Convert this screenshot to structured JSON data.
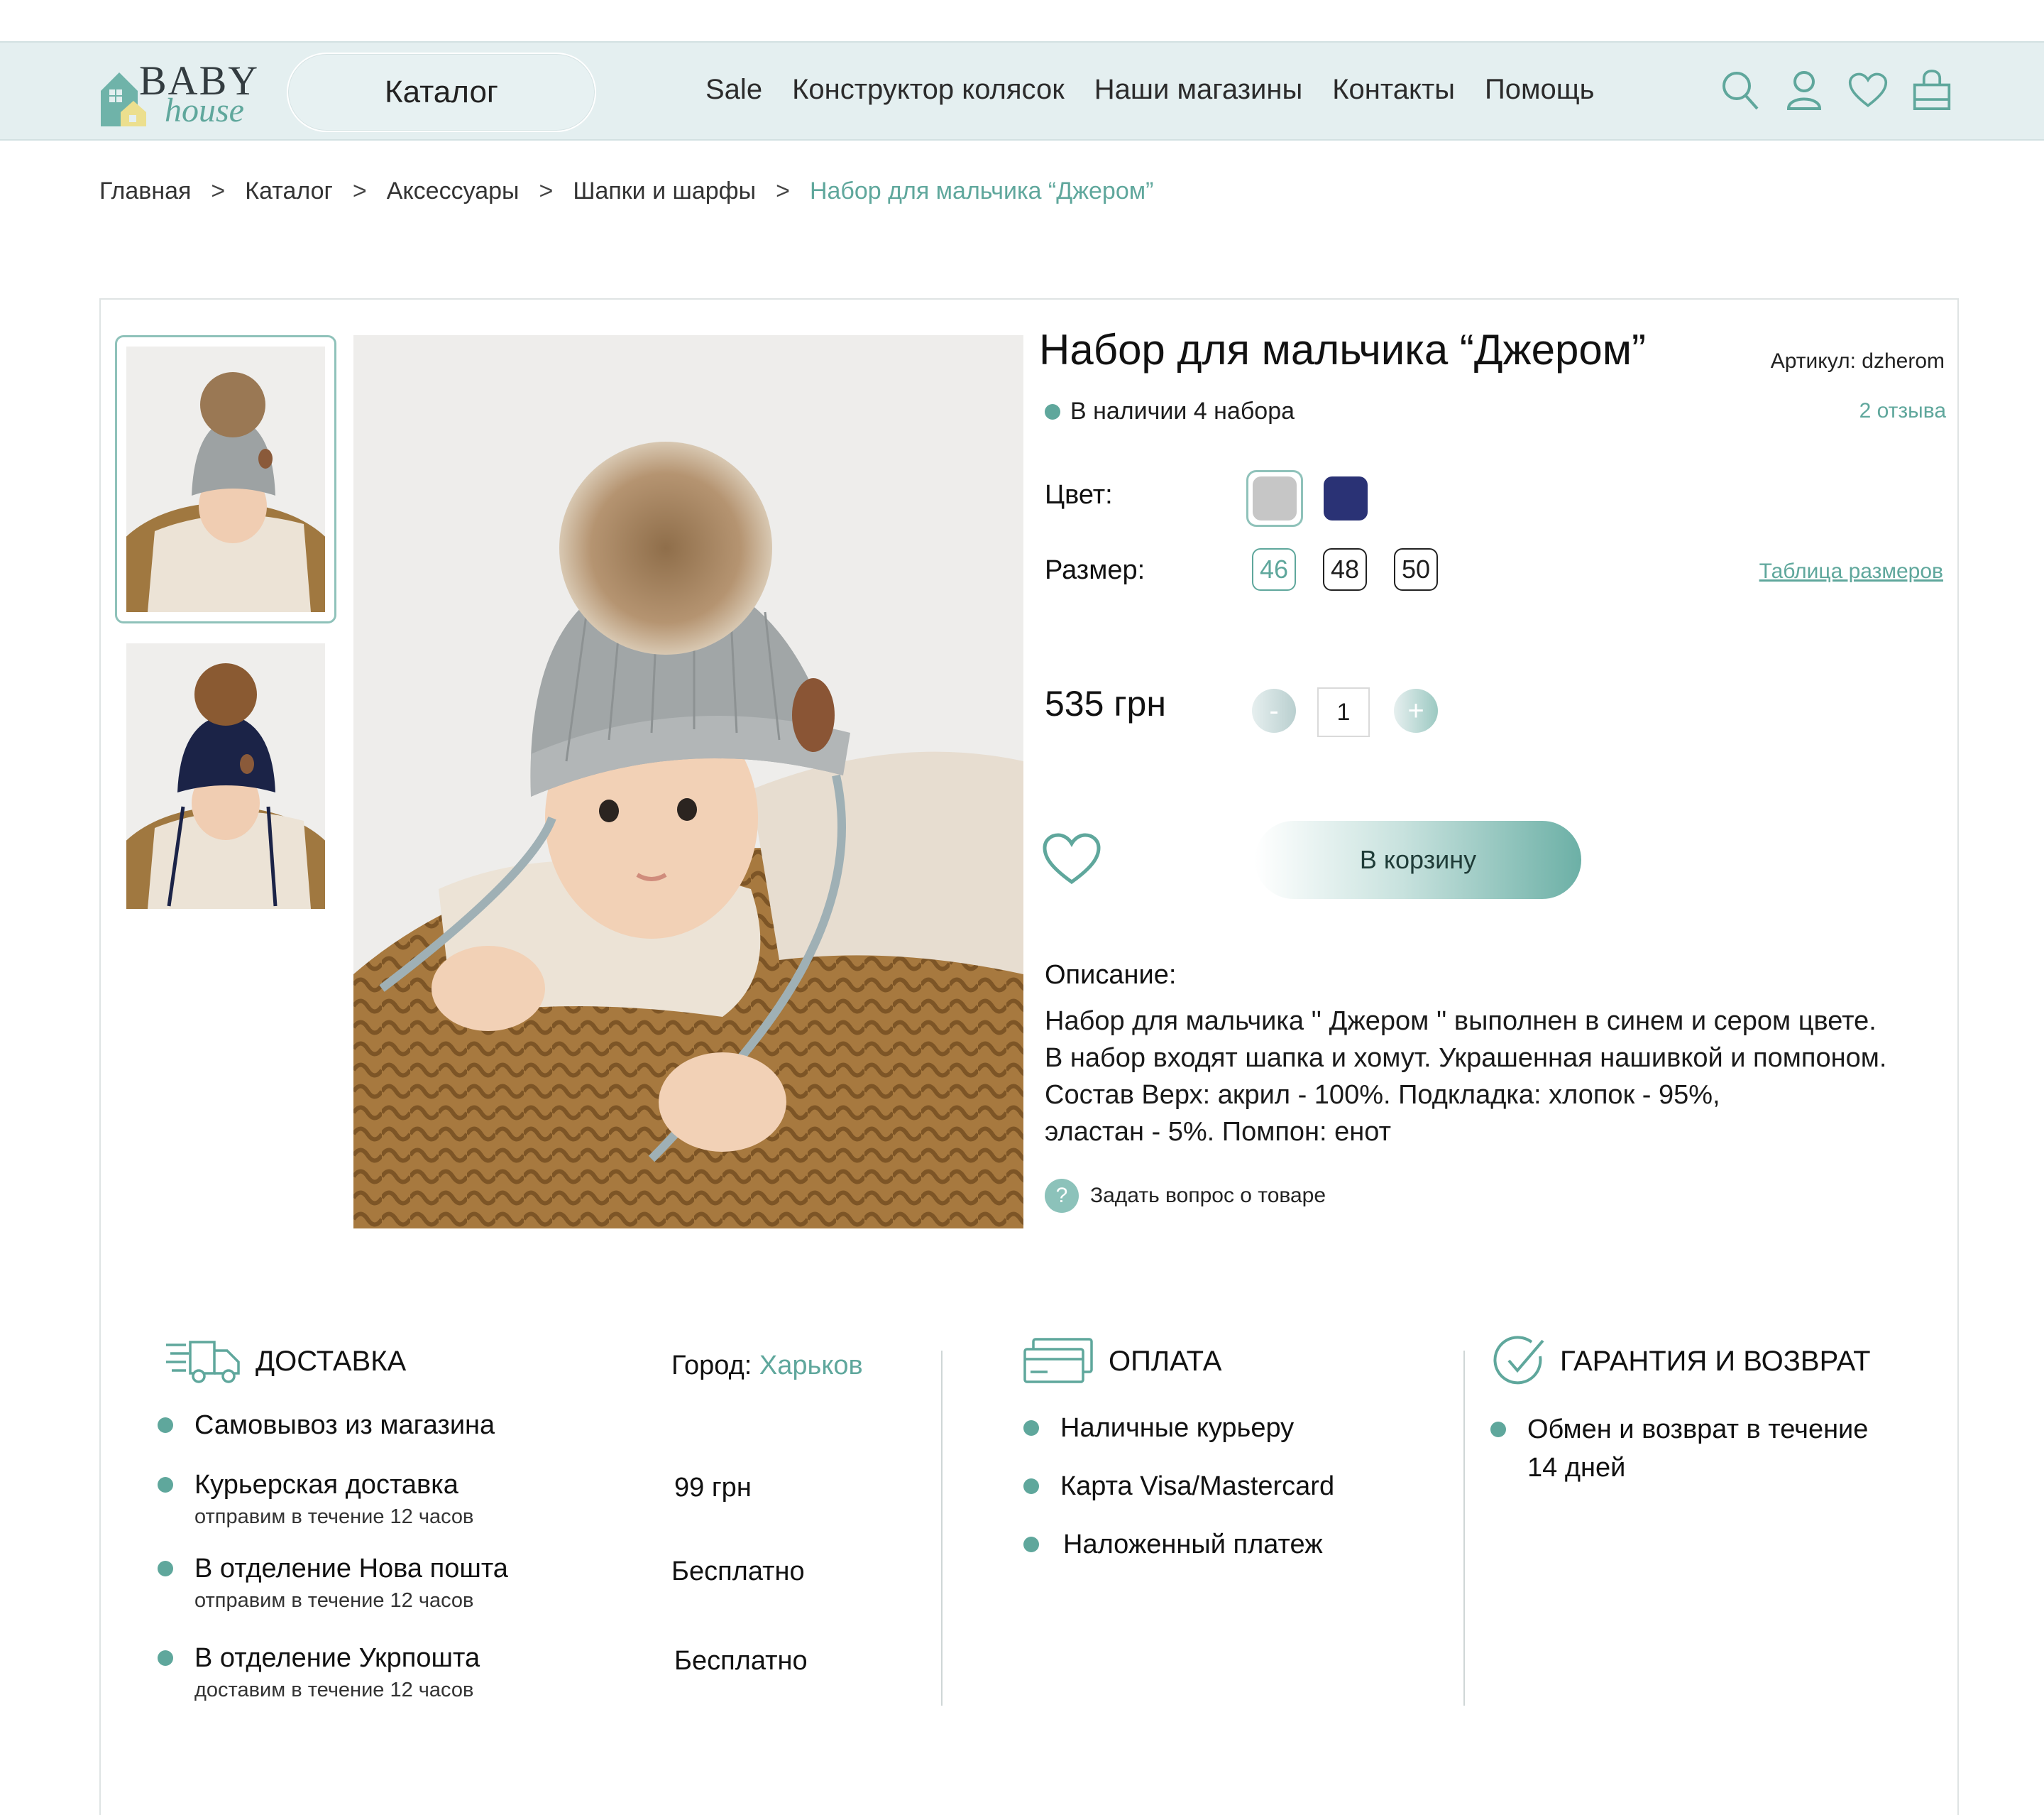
{
  "header": {
    "logo_top": "BABY",
    "logo_bottom": "house",
    "catalog_label": "Каталог",
    "nav": [
      "Sale",
      "Конструктор колясок",
      "Наши магазины",
      "Контакты",
      "Помощь"
    ],
    "icons": [
      "search-icon",
      "user-icon",
      "heart-icon",
      "bag-icon"
    ]
  },
  "breadcrumb": [
    "Главная",
    "Каталог",
    "Аксессуары",
    "Шапки и шарфы",
    "Набор для мальчика “Джером”"
  ],
  "product": {
    "title": "Набор для мальчика “Джером”",
    "sku": "Артикул: dzherom",
    "stock": "В наличии 4 набора",
    "reviews": "2 отзыва",
    "color_label": "Цвет:",
    "colors": [
      "#c6c6c6",
      "#2a3275"
    ],
    "size_label": "Размер:",
    "sizes": [
      "46",
      "48",
      "50"
    ],
    "selected_size": "46",
    "size_table_link": "Таблица размеров",
    "price": "535 грн",
    "quantity": "1",
    "qty_minus": "-",
    "qty_plus": "+",
    "add_to_cart": "В корзину",
    "description_heading": "Описание:",
    "description_lines": [
      "Набор для мальчика '' Джером '' выполнен в синем и сером цвете.",
      "В набор входят шапка и хомут. Украшенная нашивкой и помпоном.",
      "Состав Верх: акрил - 100%. Подкладка: хлопок - 95%,",
      "эластан - 5%. Помпон: енот"
    ],
    "ask_icon": "?",
    "ask_question": "Задать вопрос о товаре"
  },
  "delivery": {
    "title": "ДОСТАВКА",
    "city_label": "Город:",
    "city": "Харьков",
    "options": [
      {
        "title": "Самовывоз из магазина",
        "sub": "",
        "cost": ""
      },
      {
        "title": "Курьерская доставка",
        "sub": "отправим в течение 12 часов",
        "cost": "99 грн"
      },
      {
        "title": "В отделение Нова пошта",
        "sub": "отправим в течение 12 часов",
        "cost": "Бесплатно"
      },
      {
        "title": "В отделение Укрпошта",
        "sub": "доставим в течение 12 часов",
        "cost": "Бесплатно"
      }
    ]
  },
  "payment": {
    "title": "ОПЛАТА",
    "options": [
      "Наличные курьеру",
      "Карта Visa/Mastercard",
      "Наложенный платеж"
    ]
  },
  "guarantee": {
    "title": "ГАРАНТИЯ И ВОЗВРАТ",
    "lines": [
      "Обмен и возврат в течение",
      "14 дней"
    ]
  },
  "colors": {
    "accent": "#5fa79c",
    "header_bg": "#e4eff0",
    "text": "#1d1d1d"
  }
}
